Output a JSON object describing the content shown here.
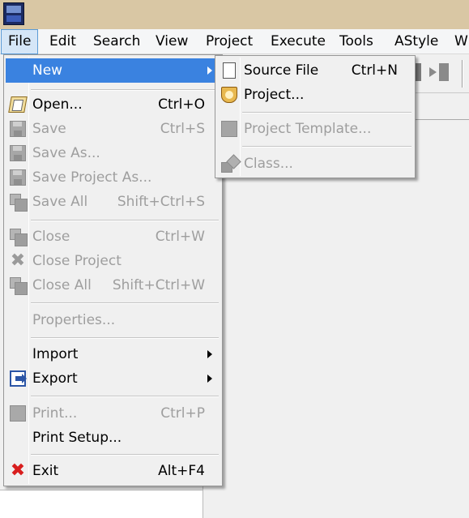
{
  "app": {
    "icon": "dev-cpp-logo-icon"
  },
  "menubar": {
    "items": [
      {
        "label": "File",
        "active": true
      },
      {
        "label": "Edit"
      },
      {
        "label": "Search"
      },
      {
        "label": "View"
      },
      {
        "label": "Project"
      },
      {
        "label": "Execute"
      },
      {
        "label": "Tools"
      },
      {
        "label": "AStyle"
      },
      {
        "label": "W"
      }
    ]
  },
  "file_menu": {
    "items": {
      "new": {
        "label": "New",
        "submenu": true,
        "highlighted": true
      },
      "open": {
        "label": "Open...",
        "shortcut": "Ctrl+O",
        "icon": "open-folder-icon"
      },
      "save": {
        "label": "Save",
        "shortcut": "Ctrl+S",
        "disabled": true,
        "icon": "save-icon"
      },
      "save_as": {
        "label": "Save As...",
        "disabled": true,
        "icon": "save-as-icon"
      },
      "save_project_as": {
        "label": "Save Project As...",
        "disabled": true,
        "icon": "save-project-as-icon"
      },
      "save_all": {
        "label": "Save All",
        "shortcut": "Shift+Ctrl+S",
        "disabled": true,
        "icon": "save-all-icon"
      },
      "close": {
        "label": "Close",
        "shortcut": "Ctrl+W",
        "disabled": true,
        "icon": "close-file-icon"
      },
      "close_project": {
        "label": "Close Project",
        "disabled": true,
        "icon": "close-project-icon"
      },
      "close_all": {
        "label": "Close All",
        "shortcut": "Shift+Ctrl+W",
        "disabled": true,
        "icon": "close-all-icon"
      },
      "properties": {
        "label": "Properties...",
        "disabled": true
      },
      "import": {
        "label": "Import",
        "submenu": true
      },
      "export": {
        "label": "Export",
        "submenu": true,
        "icon": "export-icon"
      },
      "print": {
        "label": "Print...",
        "shortcut": "Ctrl+P",
        "disabled": true,
        "icon": "print-icon"
      },
      "print_setup": {
        "label": "Print Setup..."
      },
      "exit": {
        "label": "Exit",
        "shortcut": "Alt+F4",
        "icon": "exit-icon"
      }
    }
  },
  "new_submenu": {
    "items": {
      "source_file": {
        "label": "Source File",
        "shortcut": "Ctrl+N",
        "icon": "source-file-icon"
      },
      "project": {
        "label": "Project...",
        "icon": "project-icon"
      },
      "project_template": {
        "label": "Project Template...",
        "disabled": true,
        "icon": "project-template-icon"
      },
      "class": {
        "label": "Class...",
        "disabled": true,
        "icon": "class-icon"
      }
    }
  },
  "colors": {
    "menu_highlight": "#3a82e0",
    "menu_background": "#f0f0f0",
    "disabled_text": "#9e9e9e",
    "titlebar": "#d9c7a4"
  }
}
